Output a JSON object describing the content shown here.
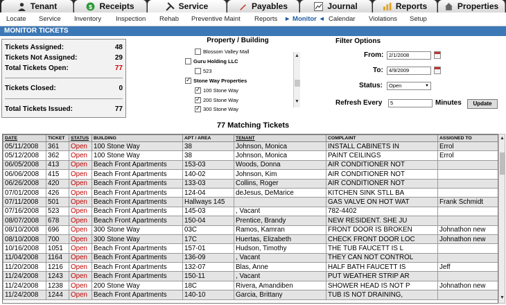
{
  "tabs": [
    {
      "label": "Tenant",
      "icon": "person-icon"
    },
    {
      "label": "Receipts",
      "icon": "dollar-icon"
    },
    {
      "label": "Service",
      "icon": "tools-icon",
      "active": true
    },
    {
      "label": "Payables",
      "icon": "pen-icon"
    },
    {
      "label": "Journal",
      "icon": "chart-line-icon"
    },
    {
      "label": "Reports",
      "icon": "bar-chart-icon"
    },
    {
      "label": "Properties",
      "icon": "house-icon"
    }
  ],
  "subnav": [
    "Locate",
    "Service",
    "Inventory",
    "Inspection",
    "Rehab",
    "Preventive Maint",
    "Reports",
    "► Monitor ◄",
    "Calendar",
    "Violations",
    "Setup"
  ],
  "header": "MONITOR TICKETS",
  "summary": {
    "assigned_label": "Tickets Assigned:",
    "assigned": "48",
    "not_assigned_label": "Tickets Not Assigned:",
    "not_assigned": "29",
    "open_label": "Total Tickets Open:",
    "open": "77",
    "closed_label": "Tickets Closed:",
    "closed": "0",
    "issued_label": "Total Tickets Issued:",
    "issued": "77"
  },
  "property": {
    "title": "Property / Building",
    "items": [
      {
        "label": "Blossom Valley Mall",
        "checked": false,
        "indent": 1
      },
      {
        "label": "Guru Holding LLC",
        "checked": false,
        "indent": 0
      },
      {
        "label": "523",
        "checked": false,
        "indent": 1
      },
      {
        "label": "Stone Way Properties",
        "checked": true,
        "indent": 0
      },
      {
        "label": "100 Stone Way",
        "checked": true,
        "indent": 1
      },
      {
        "label": "200 Stone Way",
        "checked": true,
        "indent": 1
      },
      {
        "label": "300 Stone Way",
        "checked": true,
        "indent": 1
      }
    ]
  },
  "filter": {
    "title": "Filter Options",
    "from_label": "From:",
    "from": "2/1/2008",
    "to_label": "To:",
    "to": "4/9/2009",
    "status_label": "Status:",
    "status": "Open",
    "refresh_label": "Refresh Every",
    "refresh": "5",
    "minutes_label": "Minutes",
    "update_label": "Update"
  },
  "matching": "77 Matching Tickets",
  "table": {
    "columns": [
      "DATE",
      "TICKET",
      "STATUS",
      "BUILDING",
      "APT / AREA",
      "TENANT",
      "COMPLAINT",
      "ASSIGNED TO"
    ],
    "rows": [
      [
        "05/11/2008",
        "361",
        "Open",
        "100 Stone Way",
        "38",
        "Johnson, Monica",
        "INSTALL CABINETS IN",
        "Errol"
      ],
      [
        "05/12/2008",
        "362",
        "Open",
        "100 Stone Way",
        "38",
        "Johnson, Monica",
        "PAINT CEILINGS",
        "Errol"
      ],
      [
        "06/05/2008",
        "413",
        "Open",
        "Beach Front Apartments",
        "153-03",
        "Woods, Donna",
        "AIR CONDITIONER NOT",
        ""
      ],
      [
        "06/06/2008",
        "415",
        "Open",
        "Beach Front Apartments",
        "140-02",
        "Johnson, Kim",
        "AIR CONDITIONER NOT",
        ""
      ],
      [
        "06/26/2008",
        "420",
        "Open",
        "Beach Front Apartments",
        "133-03",
        "Collins, Roger",
        "AIR CONDITIONER NOT",
        ""
      ],
      [
        "07/01/2008",
        "426",
        "Open",
        "Beach Front Apartments",
        "124-04",
        "deJesus, DeMarice",
        "KITCHEN SINK STLL BA",
        ""
      ],
      [
        "07/11/2008",
        "501",
        "Open",
        "Beach Front Apartments",
        "Hallways 145",
        "",
        "GAS VALVE ON HOT WAT",
        "Frank Schmidt"
      ],
      [
        "07/16/2008",
        "523",
        "Open",
        "Beach Front Apartments",
        "145-03",
        ", Vacant",
        "782-4402",
        ""
      ],
      [
        "08/07/2008",
        "678",
        "Open",
        "Beach Front Apartments",
        "150-04",
        "Prentice, Brandy",
        "NEW RESIDENT. SHE JU",
        ""
      ],
      [
        "08/10/2008",
        "696",
        "Open",
        "300 Stone Way",
        "03C",
        "Ramos, Kamran",
        "FRONT DOOR IS BROKEN",
        "Johnathon new"
      ],
      [
        "08/10/2008",
        "700",
        "Open",
        "300 Stone Way",
        "17C",
        "Huertas, Elizabeth",
        "CHECK FRONT DOOR LOC",
        "Johnathon new"
      ],
      [
        "10/16/2008",
        "1051",
        "Open",
        "Beach Front Apartments",
        "157-01",
        "Hudson, Timothy",
        "THE TUB FAUCETT IS L",
        ""
      ],
      [
        "11/04/2008",
        "1164",
        "Open",
        "Beach Front Apartments",
        "136-09",
        ", Vacant",
        "THEY CAN NOT CONTROL",
        ""
      ],
      [
        "11/20/2008",
        "1216",
        "Open",
        "Beach Front Apartments",
        "132-07",
        "Blas, Anne",
        "HALF BATH FAUCETT IS",
        "Jeff"
      ],
      [
        "11/24/2008",
        "1243",
        "Open",
        "Beach Front Apartments",
        "150-11",
        ", Vacant",
        "PUT WEATHER STRIP AR",
        ""
      ],
      [
        "11/24/2008",
        "1238",
        "Open",
        "200 Stone Way",
        "18C",
        "Rivera, Amandiben",
        "SHOWER HEAD IS NOT P",
        "Johnathon new"
      ],
      [
        "11/24/2008",
        "1244",
        "Open",
        "Beach Front Apartments",
        "140-10",
        "Garcia, Brittany",
        "TUB IS NOT DRAINING,",
        ""
      ]
    ]
  }
}
